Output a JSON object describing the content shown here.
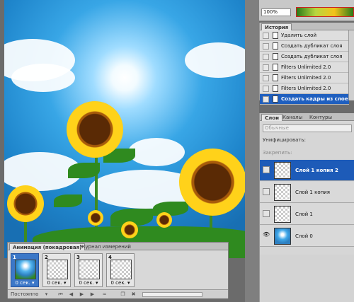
{
  "toolbar": {
    "zoom": "100%"
  },
  "history": {
    "tab": "История",
    "items": [
      "Удалить слой",
      "Создать дубликат слоя",
      "Создать дубликат слоя",
      "Filters Unlimited 2.0",
      "Filters Unlimited 2.0",
      "Filters Unlimited 2.0",
      "Создать кадры из слоев"
    ],
    "selected_index": 6
  },
  "layers_panel": {
    "tabs": [
      "Слои",
      "Каналы",
      "Контуры"
    ],
    "blend_mode": "Обычные",
    "unify_label": "Унифицировать:",
    "lock_label": "Закрепить:",
    "layers": [
      {
        "name": "Слой 1 копия 2",
        "visible": false,
        "photo": false,
        "selected": true
      },
      {
        "name": "Слой 1 копия",
        "visible": false,
        "photo": false,
        "selected": false
      },
      {
        "name": "Слой 1",
        "visible": false,
        "photo": false,
        "selected": false
      },
      {
        "name": "Слой 0",
        "visible": true,
        "photo": true,
        "selected": false
      }
    ]
  },
  "animation": {
    "tabs": [
      "Анимация (покадровая)",
      "Журнал измерений"
    ],
    "frames": [
      {
        "num": "1",
        "delay": "0 сек.",
        "photo": true,
        "selected": true
      },
      {
        "num": "2",
        "delay": "0 сек.",
        "photo": false,
        "selected": false
      },
      {
        "num": "3",
        "delay": "0 сек.",
        "photo": false,
        "selected": false
      },
      {
        "num": "4",
        "delay": "0 сек.",
        "photo": false,
        "selected": false
      }
    ],
    "loop": "Постоянно"
  },
  "icons": {
    "eye": "eye-icon",
    "history_state": "history-state-icon",
    "play": "play-icon",
    "first_frame": "first-frame-icon",
    "prev_frame": "prev-frame-icon",
    "next_frame": "next-frame-icon",
    "tween": "tween-icon",
    "new_frame": "new-frame-icon",
    "delete_frame": "trash-icon"
  },
  "colors": {
    "selection": "#1d5bb8",
    "panel": "#d6d6d6",
    "annotation_arrow": "#e02020"
  }
}
